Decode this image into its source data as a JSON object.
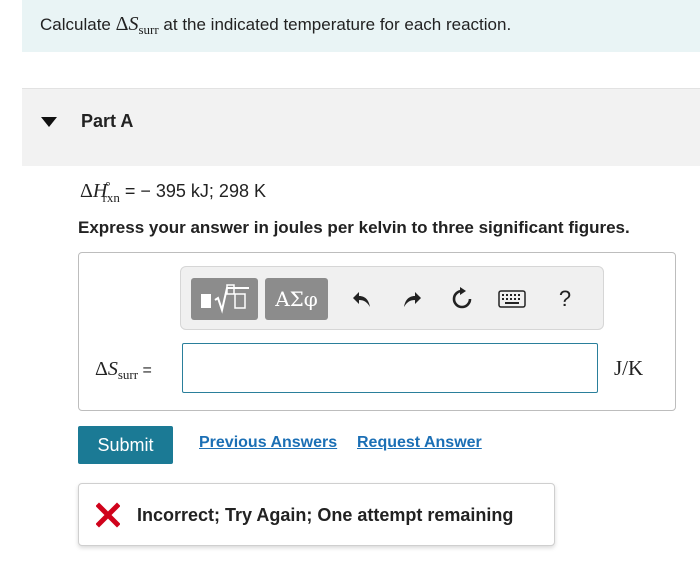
{
  "intro": {
    "prefix": "Calculate ",
    "symbol_delta": "Δ",
    "symbol_S": "S",
    "symbol_sub": "surr",
    "suffix": " at the indicated temperature for each reaction."
  },
  "part": {
    "title": "Part A"
  },
  "given": {
    "symbol_delta": "Δ",
    "symbol_H": "H",
    "sup": "°",
    "sub": "rxn",
    "value_text": " = − 395 kJ; 298 K"
  },
  "instruction": "Express your answer in joules per kelvin to three significant figures.",
  "toolbar": {
    "greek_label": "ΑΣφ",
    "help_label": "?",
    "icons": [
      "template-icon",
      "undo-icon",
      "redo-icon",
      "reset-icon",
      "keyboard-icon",
      "help-icon"
    ]
  },
  "answer": {
    "label_delta": "Δ",
    "label_S": "S",
    "label_sub": "surr",
    "label_eq": " =",
    "value": "",
    "unit": "J/K"
  },
  "actions": {
    "submit_label": "Submit",
    "previous_answers_label": "Previous Answers",
    "request_answer_label": "Request Answer"
  },
  "feedback": {
    "message": "Incorrect; Try Again; One attempt remaining",
    "icon": "x-icon"
  },
  "colors": {
    "intro_bg": "#e9f4f5",
    "accent": "#1b7a95",
    "link": "#1b6fb5",
    "error": "#d0021b",
    "toolbar_button": "#8c8c8c"
  }
}
